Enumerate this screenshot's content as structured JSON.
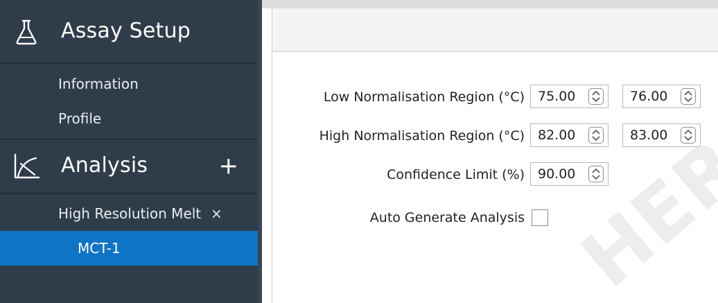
{
  "sidebar": {
    "assay_setup": {
      "title": "Assay Setup",
      "icon": "flask-icon",
      "items": [
        {
          "label": "Information"
        },
        {
          "label": "Profile"
        }
      ]
    },
    "analysis": {
      "title": "Analysis",
      "icon": "chart-curve-icon",
      "add_label": "+",
      "items": [
        {
          "label": "High Resolution Melt",
          "close_label": "×"
        },
        {
          "label": "MCT-1",
          "selected": true
        }
      ]
    }
  },
  "form": {
    "low_norm": {
      "label": "Low Normalisation Region (°C)",
      "value1": "75.00",
      "value2": "76.00"
    },
    "high_norm": {
      "label": "High Normalisation Region (°C)",
      "value1": "82.00",
      "value2": "83.00"
    },
    "confidence": {
      "label": "Confidence Limit (%)",
      "value": "90.00"
    },
    "auto_generate": {
      "label": "Auto Generate Analysis",
      "checked": false
    }
  },
  "watermark": "HER",
  "colors": {
    "sidebar_bg": "#2f3d4a",
    "selected_bg": "#0f74c4",
    "panel_header_bg": "#f4f4f4"
  }
}
